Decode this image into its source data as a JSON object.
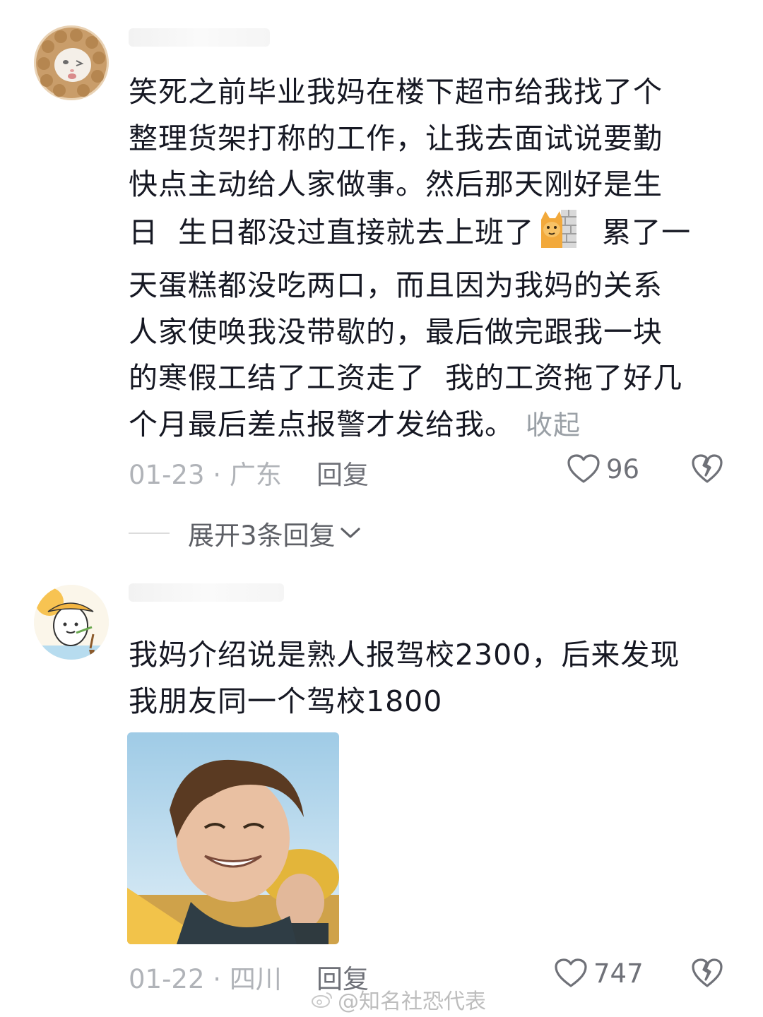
{
  "comments": [
    {
      "avatar_icon": "cat-in-knit-hood-avatar",
      "text_before_emoji": "笑死之前毕业我妈在楼下超市给我找了个\n整理货架打称的工作，让我去面试说要勤\n快点主动给人家做事。然后那天刚好是生\n日  生日都没过直接就去上班了",
      "emoji": "cat-behind-wall-emoji",
      "text_after_emoji": "  累了一\n天蛋糕都没吃两口，而且因为我妈的关系\n人家使唤我没带歇的，最后做完跟我一块\n的寒假工结了工资走了  我的工资拖了好几\n个月最后差点报警才发给我。",
      "collapse_label": "收起",
      "date": "01-23",
      "location": "广东",
      "reply_label": "回复",
      "like_count": "96",
      "expand_replies_label": "展开3条回复"
    },
    {
      "avatar_icon": "cartoon-egg-with-straw-hat-avatar",
      "text": "我妈介绍说是熟人报驾校2300，后来发现\n我朋友同一个驾校1800",
      "image": "smiling-young-man-photo",
      "date": "01-22",
      "location": "四川",
      "reply_label": "回复",
      "like_count": "747"
    }
  ],
  "watermark": "@知名社恐代表",
  "colors": {
    "text": "#161823",
    "secondary": "#6f7178",
    "muted": "#b0b3b8"
  }
}
